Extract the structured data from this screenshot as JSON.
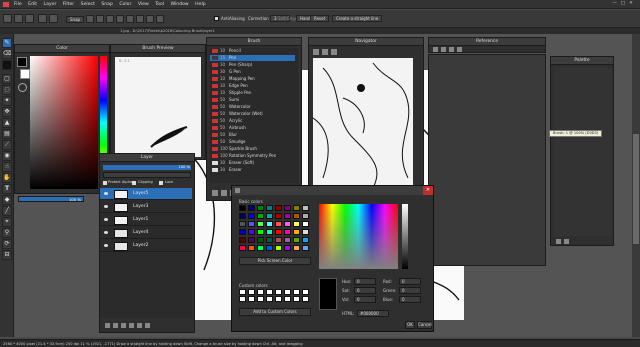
{
  "app": {
    "menu": [
      "File",
      "Edit",
      "Layer",
      "Filter",
      "Select",
      "Snap",
      "Color",
      "View",
      "Tool",
      "Window",
      "Help"
    ],
    "file_path": "1.jpg - D:\\2017\\Fleeks\\b2016\\Colouring Brush\\layer1"
  },
  "toolbar": {
    "snap_label": "Snap",
    "antialiasing_label": "AntiAliasing",
    "correction_label": "Correction",
    "correction_value": "3",
    "soft_edge_label": "Soft Edge",
    "hand_label": "Hand",
    "reset_label": "Reset",
    "straight_line_label": "Create a straight line"
  },
  "color_panel": {
    "title": "Color"
  },
  "brush_preview": {
    "title": "Brush Preview",
    "note": "B: 1:1"
  },
  "brush": {
    "title": "Brush",
    "items": [
      {
        "n": "10",
        "label": "Pencil",
        "color": "#cc3333"
      },
      {
        "n": "15",
        "label": "Pen",
        "color": "#3a3a3a"
      },
      {
        "n": "10",
        "label": "Pen (Sharp)",
        "color": "#cc3333"
      },
      {
        "n": "30",
        "label": "G Pen",
        "color": "#cc3333"
      },
      {
        "n": "10",
        "label": "Mapping Pen",
        "color": "#cc3333"
      },
      {
        "n": "10",
        "label": "Edge Pen",
        "color": "#cc3333"
      },
      {
        "n": "10",
        "label": "Stipple Pen",
        "color": "#cc3333"
      },
      {
        "n": "50",
        "label": "Sumi",
        "color": "#cc3333"
      },
      {
        "n": "50",
        "label": "Watercolor",
        "color": "#cc3333"
      },
      {
        "n": "50",
        "label": "Watercolor (Wet)",
        "color": "#cc3333"
      },
      {
        "n": "50",
        "label": "Acrylic",
        "color": "#cc3333"
      },
      {
        "n": "50",
        "label": "Airbrush",
        "color": "#cc3333"
      },
      {
        "n": "50",
        "label": "Blur",
        "color": "#cc3333"
      },
      {
        "n": "50",
        "label": "Smudge",
        "color": "#cc3333"
      },
      {
        "n": "100",
        "label": "Sparkle Brush",
        "color": "#cc3333"
      },
      {
        "n": "100",
        "label": "Rotation Symmetry Pen",
        "color": "#cc3333"
      },
      {
        "n": "30",
        "label": "Eraser (Soft)",
        "color": "#dddddd"
      },
      {
        "n": "30",
        "label": "Eraser",
        "color": "#dddddd"
      }
    ]
  },
  "navigator": {
    "title": "Navigator"
  },
  "reference": {
    "title": "Reference"
  },
  "palette": {
    "title": "Palette",
    "tooltip": "Brush: 1 @ 100% (D3D3)"
  },
  "layer": {
    "title": "Layer",
    "opacity": "100 %",
    "protect_alpha": "Protect Alpha",
    "clipping": "Clipping",
    "lock": "Lock",
    "layers": [
      "Layer5",
      "Layer3",
      "Layer1",
      "Layer4",
      "Layer2"
    ]
  },
  "size_value": "100 %",
  "color_dialog": {
    "basic_colors_label": "Basic colors",
    "pick_screen_label": "Pick Screen Color",
    "custom_colors_label": "Custom colors",
    "add_custom_label": "Add to Custom Colors",
    "hue_label": "Hue:",
    "hue": "0",
    "sat_label": "Sat:",
    "sat": "0",
    "val_label": "Val:",
    "val": "0",
    "red_label": "Red:",
    "red": "0",
    "green_label": "Green:",
    "green": "0",
    "blue_label": "Blue:",
    "blue": "0",
    "html_label": "HTML:",
    "html": "#000000",
    "ok_label": "OK",
    "cancel_label": "Cancel",
    "basic_colors": [
      "#000000",
      "#000080",
      "#008000",
      "#008080",
      "#800000",
      "#800080",
      "#808000",
      "#c0c0c0",
      "#000055",
      "#0000ff",
      "#00aa00",
      "#00aaaa",
      "#aa0000",
      "#aa00aa",
      "#aa5500",
      "#aaaaaa",
      "#555555",
      "#5555ff",
      "#55ff55",
      "#55ffff",
      "#ff5555",
      "#ff55ff",
      "#ffff55",
      "#ffffff",
      "#0000aa",
      "#5500ff",
      "#00ff00",
      "#00ffaa",
      "#ff0000",
      "#ff00aa",
      "#ffaa00",
      "#dddddd",
      "#550000",
      "#550055",
      "#005500",
      "#005555",
      "#aa5555",
      "#aa55aa",
      "#55aa00",
      "#00aaff",
      "#ff0055",
      "#ff5500",
      "#00ff55",
      "#0055ff",
      "#aaff00",
      "#aa00ff",
      "#ffaa55",
      "#55aaff"
    ]
  },
  "status": {
    "text": "2560 * 4000 pixel  (21.4 * 33.9cm)  250 dpi  11 %  (1921, -1771)  Draw a straight line by holding down Shift, Change a brush size by holding down Ctrl, Alt, and dragging"
  }
}
